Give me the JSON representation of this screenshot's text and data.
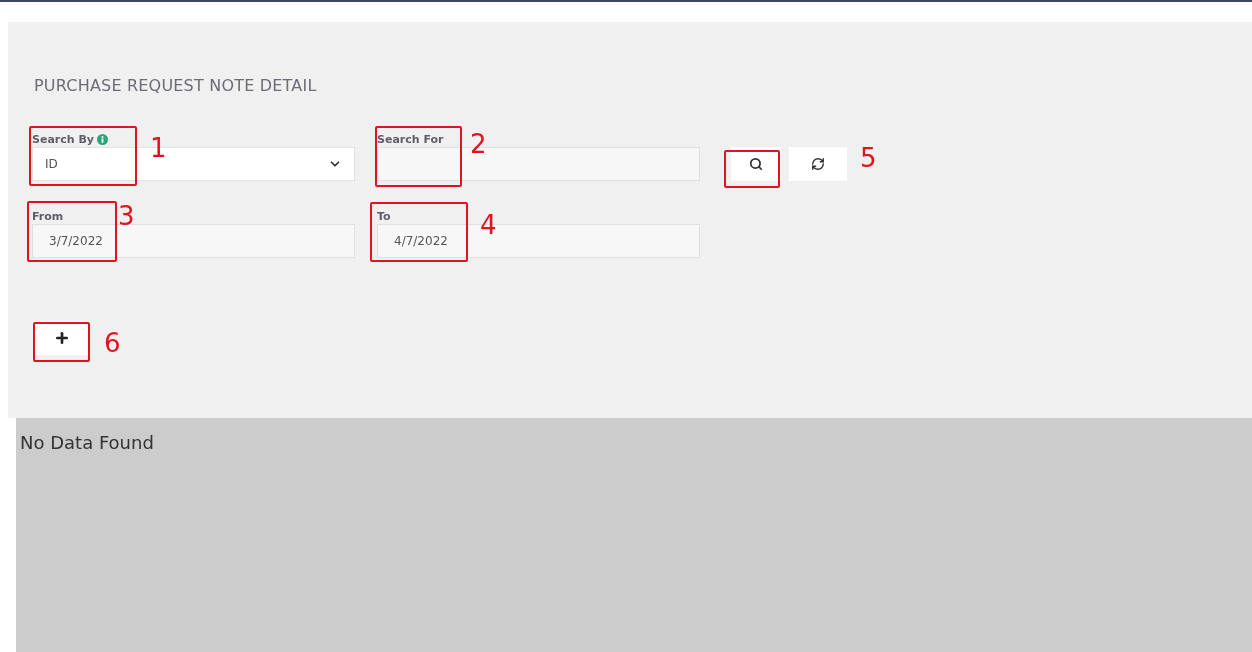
{
  "title": "PURCHASE REQUEST NOTE DETAIL",
  "filters": {
    "search_by": {
      "label": "Search By",
      "value": "ID"
    },
    "search_for": {
      "label": "Search For"
    },
    "from": {
      "label": "From",
      "value": "3/7/2022"
    },
    "to": {
      "label": "To",
      "value": "4/7/2022"
    }
  },
  "results": {
    "message": "No Data Found"
  },
  "annotations": [
    {
      "number": "1"
    },
    {
      "number": "2"
    },
    {
      "number": "3"
    },
    {
      "number": "4"
    },
    {
      "number": "5"
    },
    {
      "number": "6"
    }
  ]
}
